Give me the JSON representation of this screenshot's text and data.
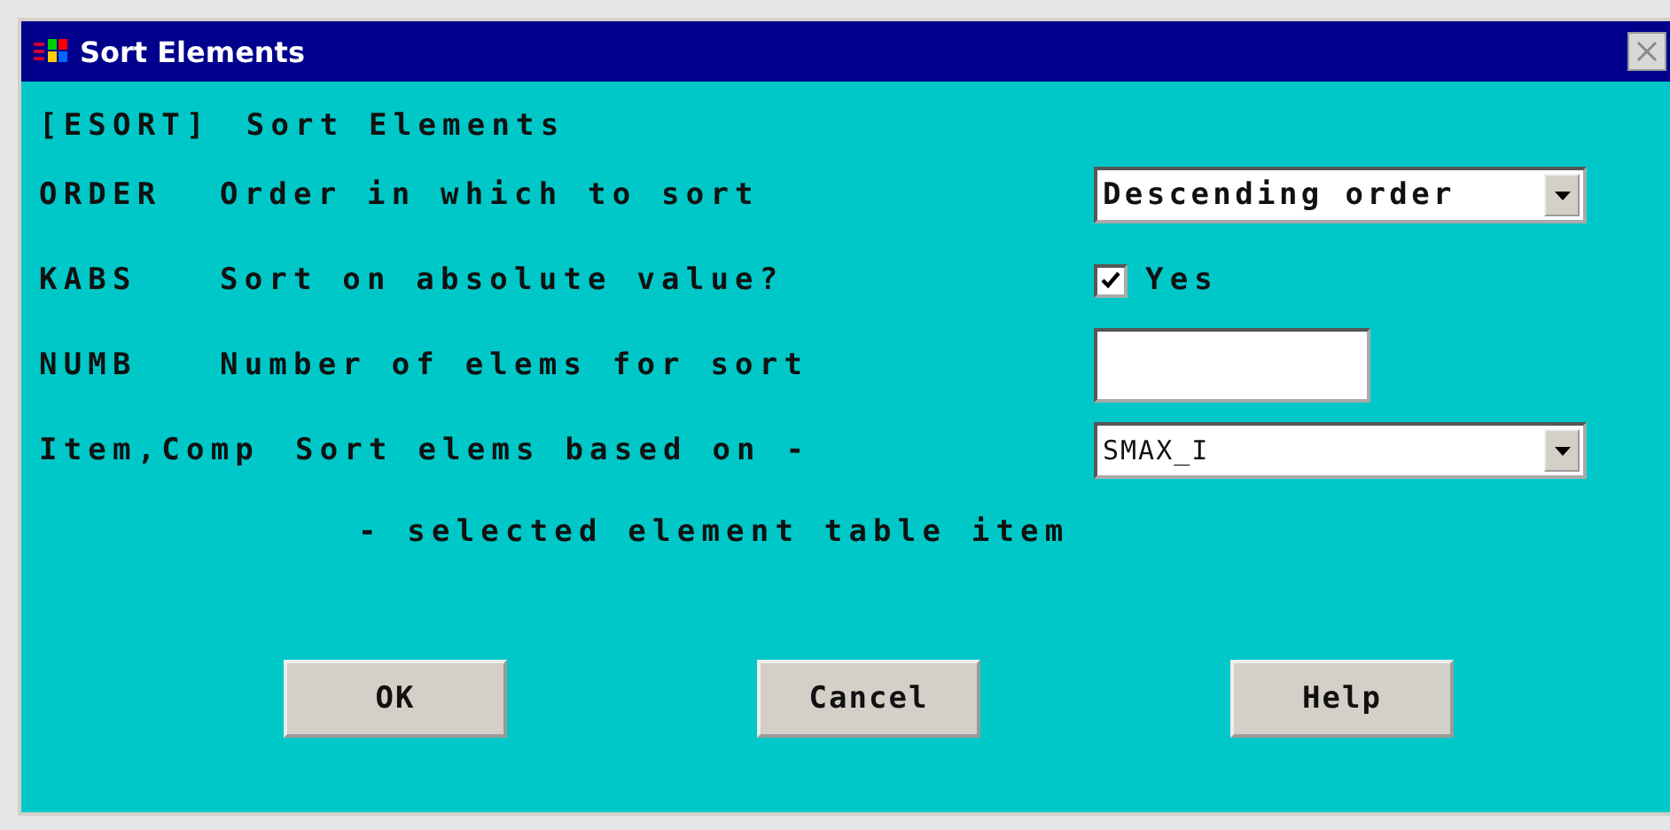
{
  "window": {
    "title": "Sort Elements"
  },
  "command": {
    "key": "[ESORT]",
    "label": "Sort Elements"
  },
  "fields": [
    {
      "kind": "dropdown",
      "key": "ORDER",
      "label": "Order in which to sort",
      "value": "Descending order"
    },
    {
      "kind": "checkbox",
      "key": "KABS",
      "label": "Sort on absolute value?",
      "option": "Yes",
      "checked": true
    },
    {
      "kind": "text",
      "key": "NUMB",
      "label": "Number of elems for sort"
    },
    {
      "kind": "dropdown",
      "key": "Item,Comp",
      "label": "Sort elems based on -",
      "value": "SMAX_I"
    }
  ],
  "note": "- selected element table item",
  "buttons": [
    "OK",
    "Cancel",
    "Help"
  ]
}
